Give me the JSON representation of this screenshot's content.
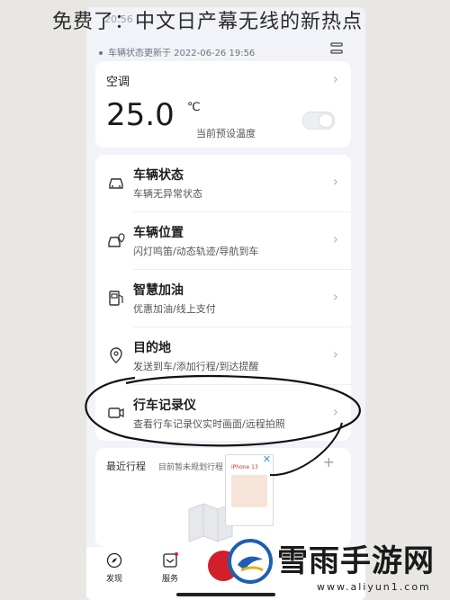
{
  "overlay": {
    "title": "免费了：中文日产幕无线的新热点"
  },
  "status": {
    "time": "20:56"
  },
  "header": {
    "vehicle_status_line": "车辆状态更新于 2022-06-26 19:56"
  },
  "climate": {
    "title": "空调",
    "temperature": "25.0",
    "unit": "℃",
    "subtitle": "当前预设温度",
    "toggle_on": false
  },
  "menu": [
    {
      "icon": "car-icon",
      "title": "车辆状态",
      "subtitle": "车辆无异常状态"
    },
    {
      "icon": "car-location-icon",
      "title": "车辆位置",
      "subtitle": "闪灯鸣笛/动态轨迹/导航到车"
    },
    {
      "icon": "fuel-pump-icon",
      "title": "智慧加油",
      "subtitle": "优惠加油/线上支付"
    },
    {
      "icon": "location-pin-icon",
      "title": "目的地",
      "subtitle": "发送到车/添加行程/到达提醒"
    },
    {
      "icon": "dashcam-icon",
      "title": "行车记录仪",
      "subtitle": "查看行车记录仪实时画面/远程拍照"
    }
  ],
  "recent": {
    "title": "最近行程",
    "subtitle": "目前暂未规划行程"
  },
  "ad": {
    "text": "iPhone 13"
  },
  "tabs": [
    {
      "icon": "compass-icon",
      "label": "发现"
    },
    {
      "icon": "service-icon",
      "label": "服务"
    }
  ],
  "watermark": {
    "name": "雪雨手游网",
    "url": "www.aliyun1.com"
  },
  "colors": {
    "brand_red": "#d1202b",
    "page_bg": "#f1f3f8",
    "watermark_blue": "#1f5fb3"
  }
}
